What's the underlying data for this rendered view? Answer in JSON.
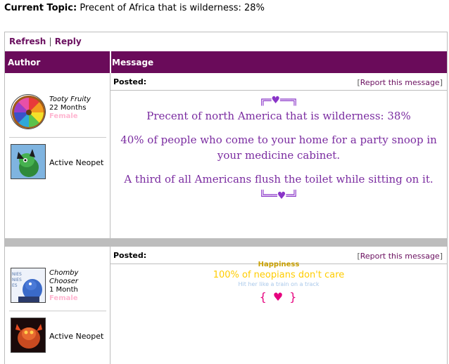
{
  "topic": {
    "label": "Current Topic:",
    "text": "Precent of Africa that is wilderness: 28%"
  },
  "actions": {
    "refresh": "Refresh",
    "separator": "|",
    "reply": "Reply"
  },
  "header": {
    "author": "Author",
    "message": "Message"
  },
  "posts": [
    {
      "posted_label": "Posted:",
      "report_open": "[",
      "report_text": "Report this message",
      "report_close": "]",
      "user": {
        "name": "Tooty Fruity",
        "age": "22 Months",
        "gender": "Female"
      },
      "neopet_label": "Active Neopet",
      "message_lines": [
        "Precent of north America that is wilderness: 38%",
        "40% of people who come to your home for a party snoop in your medicine cabinet.",
        "A third of all Americans flush the toilet while sitting on it."
      ],
      "decoration_top": "╔═♥══╗",
      "decoration_bottom": "╚══♥═╝"
    },
    {
      "posted_label": "Posted:",
      "report_open": "[",
      "report_text": "Report this message",
      "report_close": "]",
      "user": {
        "name": "Chomby Chooser",
        "age": "1 Month",
        "gender": "Female"
      },
      "neopet_label": "Active Neopet",
      "signature": {
        "title": "Happiness",
        "line": "100% of neopians don't care",
        "small": "Hit her like a train on a track",
        "heart": "{ ♥ }"
      }
    }
  ],
  "colors": {
    "header_bg": "#6a0b5a",
    "link": "#6a0f5f",
    "message_text": "#7a2ba0",
    "gender": "#ffb6d1"
  }
}
